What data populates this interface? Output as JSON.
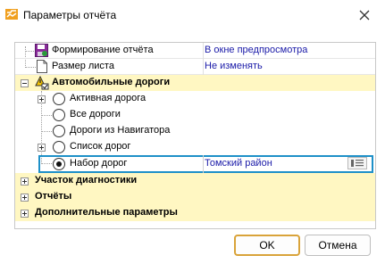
{
  "window": {
    "title": "Параметры отчёта"
  },
  "tree": {
    "rows": [
      {
        "label": "Формирование отчёта",
        "value": "В окне предпросмотра"
      },
      {
        "label": "Размер листа",
        "value": "Не изменять"
      },
      {
        "label": "Автомобильные дороги"
      },
      {
        "label": "Активная дорога"
      },
      {
        "label": "Все дороги"
      },
      {
        "label": "Дороги из Навигатора"
      },
      {
        "label": "Список дорог"
      },
      {
        "label": "Набор дорог",
        "value": "Томский район"
      },
      {
        "label": "Участок диагностики"
      },
      {
        "label": "Отчёты"
      },
      {
        "label": "Дополнительные параметры"
      }
    ]
  },
  "buttons": {
    "ok": "OK",
    "cancel": "Отмена"
  },
  "colors": {
    "category_bg": "#fff7c2",
    "value_text": "#1a1aa8",
    "selection": "#1e90c8",
    "primary_border": "#d9a33a"
  }
}
